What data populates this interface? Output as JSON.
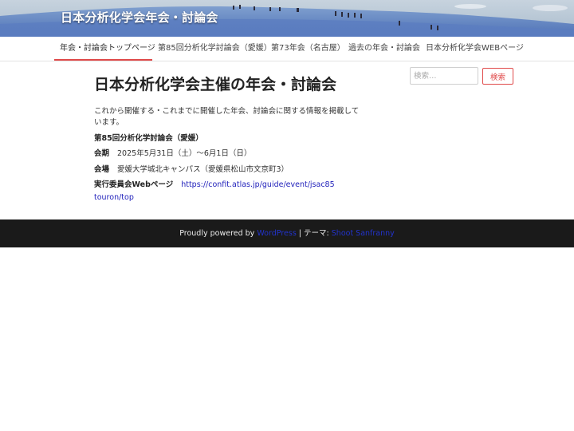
{
  "site": {
    "title": "日本分析化学会年会・討論会"
  },
  "nav": {
    "items": [
      {
        "label": "年会・討論会トップページ",
        "active": true
      },
      {
        "label": "第85回分析化学討論会（愛媛）"
      },
      {
        "label": "第73年会（名古屋）"
      },
      {
        "label": "過去の年会・討論会"
      },
      {
        "label": "日本分析化学会WEBページ"
      }
    ],
    "active_color": "#e04a4a"
  },
  "main": {
    "title": "日本分析化学会主催の年会・討論会",
    "intro": "これから開催する・これまでに開催した年会、討論会に関する情報を掲載しています。",
    "event": {
      "title": "第85回分析化学討論会（愛媛）",
      "date_label": "会期",
      "date_value": "2025年5月31日（土）〜6月1日（日）",
      "venue_label": "会場",
      "venue_value": "愛媛大学城北キャンパス（愛媛県松山市文京町3）",
      "web_label": "実行委員会Webページ",
      "web_link_line1": "https://confit.atlas.jp/guide/event/jsac85",
      "web_link_line2": "touron/top"
    }
  },
  "search": {
    "placeholder": "検索…",
    "button_label": "検索",
    "accent": "#e04a4a"
  },
  "footer": {
    "prefix": "Proudly powered by",
    "wordpress": "WordPress",
    "separator": "|",
    "theme_label": "テーマ:",
    "theme_name": "Shoot Sanfranny"
  }
}
